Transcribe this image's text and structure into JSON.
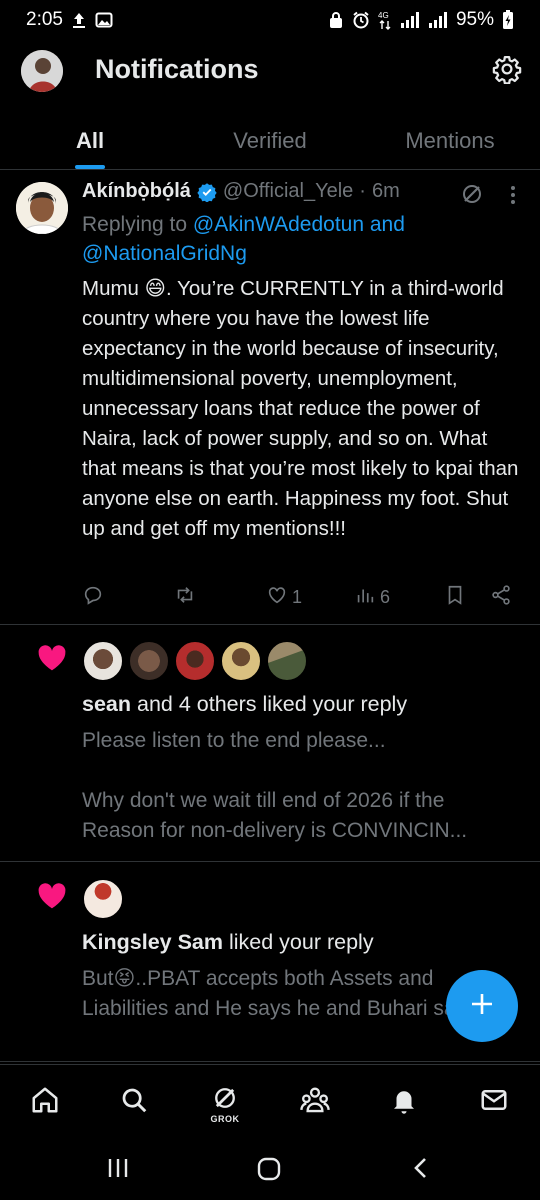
{
  "status_bar": {
    "time": "2:05",
    "battery": "95%"
  },
  "header": {
    "title": "Notifications"
  },
  "tabs": [
    {
      "label": "All"
    },
    {
      "label": "Verified"
    },
    {
      "label": "Mentions"
    }
  ],
  "post": {
    "name": "Akínbọ̀bọ́lá",
    "handle": "@Official_Yele",
    "separator": "·",
    "time": "6m",
    "replying_prefix": "Replying to ",
    "reply_link_1": "@AkinWAdedotun and",
    "reply_link_2": "@NationalGridNg",
    "body": "Mumu 😄. You’re CURRENTLY in a third-world country where you have the lowest life expectancy in the world because of insecurity, multidimensional poverty, unemployment, unnecessary loans that reduce the power of Naira, lack of power supply, and so on. What that means is that you’re most likely to kpai than anyone else on earth. Happiness my foot. Shut up and get off my mentions!!!",
    "likes": "1",
    "views": "6"
  },
  "notifications": [
    {
      "actor": "sean",
      "rest": " and 4 others liked your reply",
      "text_1": "Please listen to the end please...",
      "text_2": "Why don't we wait till end of 2026 if the Reason for non-delivery is CONVINCIN..."
    },
    {
      "actor": "Kingsley Sam",
      "rest": " liked your reply",
      "text_1": "But😝..PBAT accepts both Assets and Liabilities and He says he and Buhari same...."
    }
  ],
  "bottom_nav": {
    "grok_label": "GROK"
  },
  "colors": {
    "accent": "#1d9bf0",
    "heart": "#f91880",
    "muted": "#71767b",
    "background": "#000000"
  }
}
